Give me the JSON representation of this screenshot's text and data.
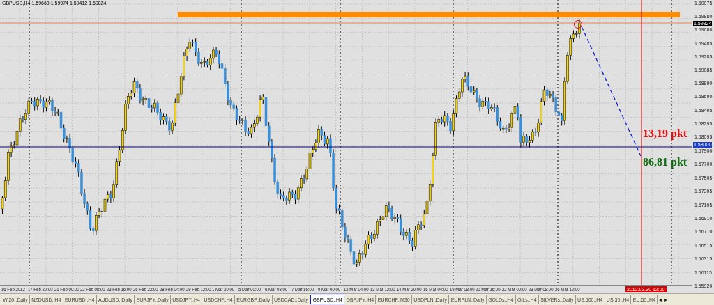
{
  "chart": {
    "title": "GBPUSD,H4 1.59660 1.59974 1.59412 1.59824",
    "annotations": [
      {
        "text": "13,19 pkt",
        "color": "#e01010"
      },
      {
        "text": "86,81 pkt",
        "color": "#107010"
      }
    ]
  },
  "price_axis": {
    "labels": [
      "1.60075",
      "1.59880",
      "1.59680",
      "1.59485",
      "1.59285",
      "1.59085",
      "1.58890",
      "1.58690",
      "1.58495",
      "1.58295",
      "1.58095",
      "1.57900",
      "1.57700",
      "1.57505",
      "1.57305",
      "1.57105",
      "1.56910",
      "1.56710",
      "1.56515",
      "1.56315",
      "1.56115",
      "1.55920"
    ],
    "current_price": "1.59824",
    "marked_price": "1.58000"
  },
  "time_axis": {
    "labels": [
      "16 Feb 2012",
      "17 Feb 20:00",
      "21 Feb 00:00",
      "22 Feb 08:00",
      "23 Feb 16:00",
      "26 Feb 23:00",
      "28 Feb 04:00",
      "29 Feb 12:00",
      "1 Mar 20:00",
      "5 Mar 00:00",
      "6 Mar 08:00",
      "7 Mar 16:00",
      "9 Mar 00:00",
      "12 Mar 04:00",
      "13 Mar 12:00",
      "14 Mar 20:00",
      "16 Mar 04:00",
      "19 Mar 08:00",
      "20 Mar 16:00",
      "22 Mar 00:00",
      "23 Mar 08:00",
      "26 Mar 12:00"
    ],
    "cursor_label": "2012.03.30 12:00"
  },
  "tabs": [
    {
      "label": "W.20,,Daily",
      "selected": false
    },
    {
      "label": "NZDUSD,,H4",
      "selected": false
    },
    {
      "label": "EURUSD,,H4",
      "selected": false
    },
    {
      "label": "AUDUSD,,Daily",
      "selected": false
    },
    {
      "label": "EURJPY,,Daily",
      "selected": false
    },
    {
      "label": "USDJPY,,H4",
      "selected": false
    },
    {
      "label": "USDCHF,,H4",
      "selected": false
    },
    {
      "label": "EURGBP,,Daily",
      "selected": false
    },
    {
      "label": "USDCAD,,Daily",
      "selected": false
    },
    {
      "label": "GBPUSD,,H4",
      "selected": true
    },
    {
      "label": "GBPJPY,,H4",
      "selected": false
    },
    {
      "label": "EURCHF,,M30",
      "selected": false
    },
    {
      "label": "USDPLN,,Daily",
      "selected": false
    },
    {
      "label": "EURPLN,,Daily",
      "selected": false
    },
    {
      "label": "GOLDs,,H4",
      "selected": false
    },
    {
      "label": "OILs,,H4",
      "selected": false
    },
    {
      "label": "SILVERs,,Daily",
      "selected": false
    },
    {
      "label": "US.500,,H4",
      "selected": false
    },
    {
      "label": "US.30,,H4",
      "selected": false
    },
    {
      "label": "EU.50,,H4",
      "selected": false
    }
  ],
  "tab_scroll": [
    "◂",
    "▸"
  ]
}
